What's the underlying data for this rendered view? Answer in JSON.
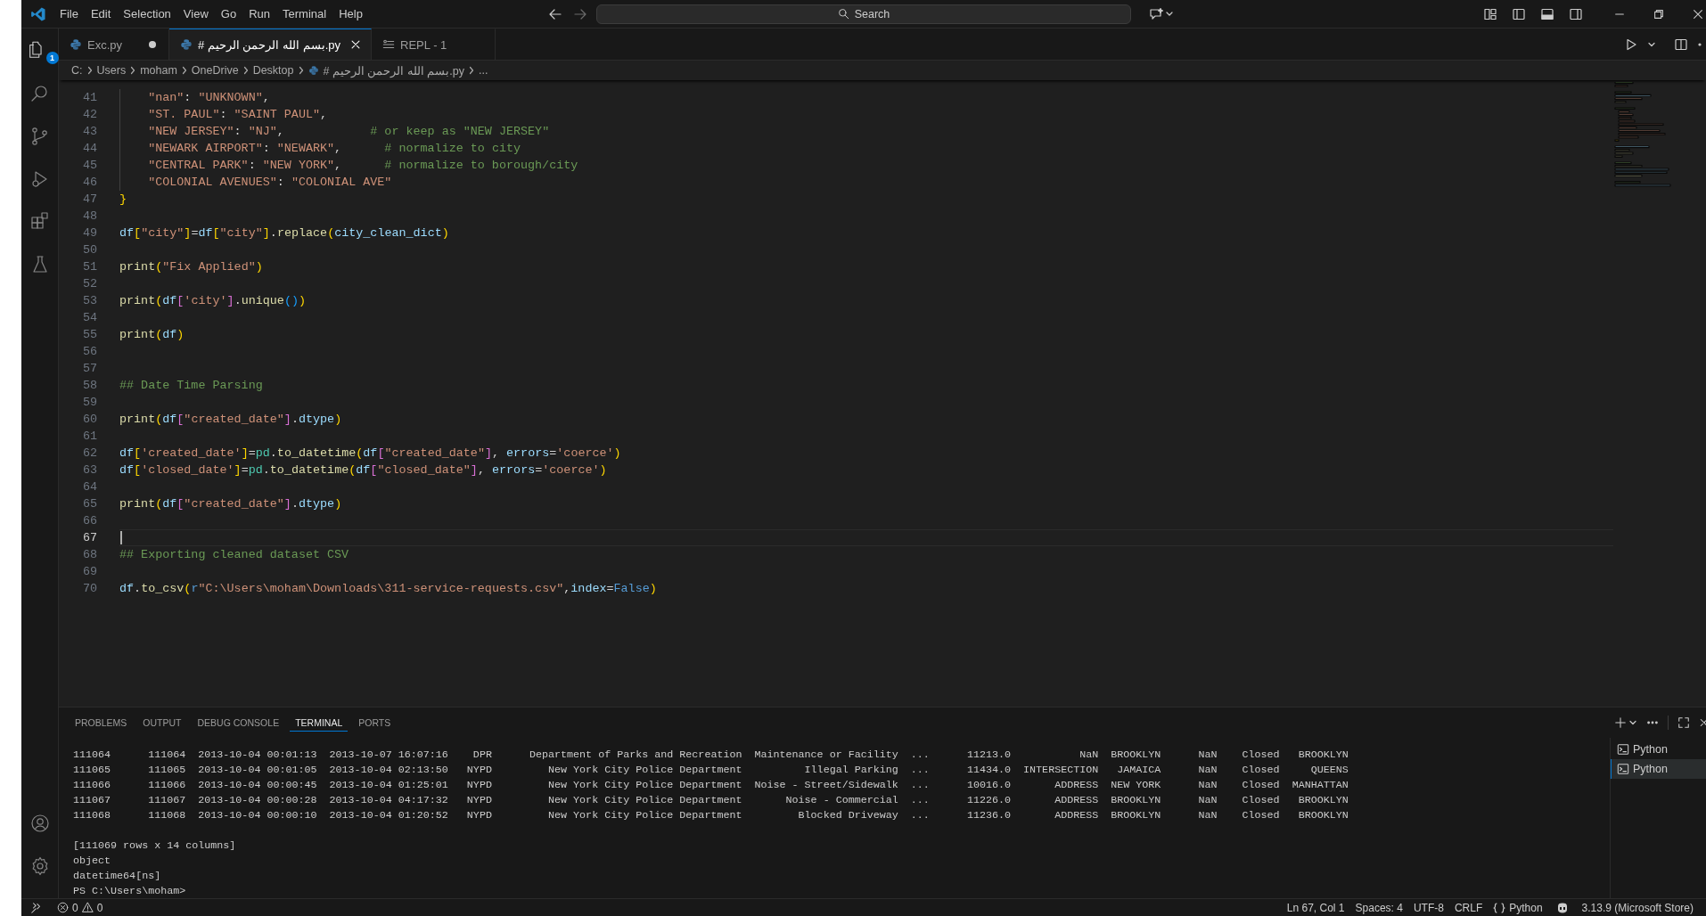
{
  "title_bar": {
    "menus": [
      "File",
      "Edit",
      "Selection",
      "View",
      "Go",
      "Run",
      "Terminal",
      "Help"
    ],
    "search": {
      "placeholder": "Search"
    }
  },
  "activity_bar": {
    "explorer_badge": "1"
  },
  "tabs": [
    {
      "label": "Exc.py",
      "kind": "python",
      "selected": false,
      "modified": true
    },
    {
      "label": "# بسم الله الرحمن الرحيم.py",
      "kind": "python",
      "selected": true,
      "modified": false
    },
    {
      "label": "REPL - 1",
      "kind": "repl",
      "selected": false,
      "modified": false
    }
  ],
  "breadcrumbs": [
    {
      "label": "C:",
      "kind": "folder"
    },
    {
      "label": "Users",
      "kind": "folder"
    },
    {
      "label": "moham",
      "kind": "folder"
    },
    {
      "label": "OneDrive",
      "kind": "folder"
    },
    {
      "label": "Desktop",
      "kind": "folder"
    },
    {
      "label": "# بسم الله الرحمن الرحيم.py",
      "kind": "python"
    },
    {
      "label": "...",
      "kind": "more"
    }
  ],
  "editor": {
    "lines": [
      {
        "number": "41",
        "current": false,
        "indented": true,
        "tokens": [
          {
            "kind": "string",
            "text": "\"nan\""
          },
          {
            "kind": "plain",
            "text": ": "
          },
          {
            "kind": "string",
            "text": "\"UNKNOWN\""
          },
          {
            "kind": "plain",
            "text": ","
          }
        ]
      },
      {
        "number": "42",
        "current": false,
        "indented": true,
        "tokens": [
          {
            "kind": "string",
            "text": "\"ST. PAUL\""
          },
          {
            "kind": "plain",
            "text": ": "
          },
          {
            "kind": "string",
            "text": "\"SAINT PAUL\""
          },
          {
            "kind": "plain",
            "text": ","
          }
        ]
      },
      {
        "number": "43",
        "current": false,
        "indented": true,
        "tokens": [
          {
            "kind": "string",
            "text": "\"NEW JERSEY\""
          },
          {
            "kind": "plain",
            "text": ": "
          },
          {
            "kind": "string",
            "text": "\"NJ\""
          },
          {
            "kind": "plain",
            "text": ",            "
          },
          {
            "kind": "comment",
            "text": "# or keep as \"NEW JERSEY\""
          }
        ]
      },
      {
        "number": "44",
        "current": false,
        "indented": true,
        "tokens": [
          {
            "kind": "string",
            "text": "\"NEWARK AIRPORT\""
          },
          {
            "kind": "plain",
            "text": ": "
          },
          {
            "kind": "string",
            "text": "\"NEWARK\""
          },
          {
            "kind": "plain",
            "text": ",      "
          },
          {
            "kind": "comment",
            "text": "# normalize to city"
          }
        ]
      },
      {
        "number": "45",
        "current": false,
        "indented": true,
        "tokens": [
          {
            "kind": "string",
            "text": "\"CENTRAL PARK\""
          },
          {
            "kind": "plain",
            "text": ": "
          },
          {
            "kind": "string",
            "text": "\"NEW YORK\""
          },
          {
            "kind": "plain",
            "text": ",      "
          },
          {
            "kind": "comment",
            "text": "# normalize to borough/city"
          }
        ]
      },
      {
        "number": "46",
        "current": false,
        "indented": true,
        "tokens": [
          {
            "kind": "string",
            "text": "\"COLONIAL AVENUES\""
          },
          {
            "kind": "plain",
            "text": ": "
          },
          {
            "kind": "string",
            "text": "\"COLONIAL AVE\""
          }
        ]
      },
      {
        "number": "47",
        "current": false,
        "tokens": [
          {
            "kind": "bracket1",
            "text": "}"
          }
        ]
      },
      {
        "number": "48",
        "current": false
      },
      {
        "number": "49",
        "current": false,
        "tokens": [
          {
            "kind": "var",
            "text": "df"
          },
          {
            "kind": "bracket1",
            "text": "["
          },
          {
            "kind": "string",
            "text": "\"city\""
          },
          {
            "kind": "bracket1",
            "text": "]"
          },
          {
            "kind": "plain",
            "text": "="
          },
          {
            "kind": "var",
            "text": "df"
          },
          {
            "kind": "bracket1",
            "text": "["
          },
          {
            "kind": "string",
            "text": "\"city\""
          },
          {
            "kind": "bracket1",
            "text": "]"
          },
          {
            "kind": "plain",
            "text": "."
          },
          {
            "kind": "fn",
            "text": "replace"
          },
          {
            "kind": "bracket1",
            "text": "("
          },
          {
            "kind": "var",
            "text": "city_clean_dict"
          },
          {
            "kind": "bracket1",
            "text": ")"
          }
        ]
      },
      {
        "number": "50",
        "current": false
      },
      {
        "number": "51",
        "current": false,
        "tokens": [
          {
            "kind": "fn",
            "text": "print"
          },
          {
            "kind": "bracket1",
            "text": "("
          },
          {
            "kind": "string",
            "text": "\"Fix Applied\""
          },
          {
            "kind": "bracket1",
            "text": ")"
          }
        ]
      },
      {
        "number": "52",
        "current": false
      },
      {
        "number": "53",
        "current": false,
        "tokens": [
          {
            "kind": "fn",
            "text": "print"
          },
          {
            "kind": "bracket1",
            "text": "("
          },
          {
            "kind": "var",
            "text": "df"
          },
          {
            "kind": "bracket2",
            "text": "["
          },
          {
            "kind": "string",
            "text": "'city'"
          },
          {
            "kind": "bracket2",
            "text": "]"
          },
          {
            "kind": "plain",
            "text": "."
          },
          {
            "kind": "fn",
            "text": "unique"
          },
          {
            "kind": "bracket3",
            "text": "()"
          },
          {
            "kind": "bracket1",
            "text": ")"
          }
        ]
      },
      {
        "number": "54",
        "current": false
      },
      {
        "number": "55",
        "current": false,
        "tokens": [
          {
            "kind": "fn",
            "text": "print"
          },
          {
            "kind": "bracket1",
            "text": "("
          },
          {
            "kind": "var",
            "text": "df"
          },
          {
            "kind": "bracket1",
            "text": ")"
          }
        ]
      },
      {
        "number": "56",
        "current": false
      },
      {
        "number": "57",
        "current": false
      },
      {
        "number": "58",
        "current": false,
        "tokens": [
          {
            "kind": "comment",
            "text": "## Date Time Parsing"
          }
        ]
      },
      {
        "number": "59",
        "current": false
      },
      {
        "number": "60",
        "current": false,
        "tokens": [
          {
            "kind": "fn",
            "text": "print"
          },
          {
            "kind": "bracket1",
            "text": "("
          },
          {
            "kind": "var",
            "text": "df"
          },
          {
            "kind": "bracket2",
            "text": "["
          },
          {
            "kind": "string",
            "text": "\"created_date\""
          },
          {
            "kind": "bracket2",
            "text": "]"
          },
          {
            "kind": "plain",
            "text": "."
          },
          {
            "kind": "var",
            "text": "dtype"
          },
          {
            "kind": "bracket1",
            "text": ")"
          }
        ]
      },
      {
        "number": "61",
        "current": false
      },
      {
        "number": "62",
        "current": false,
        "tokens": [
          {
            "kind": "var",
            "text": "df"
          },
          {
            "kind": "bracket1",
            "text": "["
          },
          {
            "kind": "string",
            "text": "'created_date'"
          },
          {
            "kind": "bracket1",
            "text": "]"
          },
          {
            "kind": "plain",
            "text": "="
          },
          {
            "kind": "module",
            "text": "pd"
          },
          {
            "kind": "plain",
            "text": "."
          },
          {
            "kind": "fn",
            "text": "to_datetime"
          },
          {
            "kind": "bracket1",
            "text": "("
          },
          {
            "kind": "var",
            "text": "df"
          },
          {
            "kind": "bracket2",
            "text": "["
          },
          {
            "kind": "string",
            "text": "\"created_date\""
          },
          {
            "kind": "bracket2",
            "text": "]"
          },
          {
            "kind": "plain",
            "text": ", "
          },
          {
            "kind": "var",
            "text": "errors"
          },
          {
            "kind": "plain",
            "text": "="
          },
          {
            "kind": "string",
            "text": "'coerce'"
          },
          {
            "kind": "bracket1",
            "text": ")"
          }
        ]
      },
      {
        "number": "63",
        "current": false,
        "tokens": [
          {
            "kind": "var",
            "text": "df"
          },
          {
            "kind": "bracket1",
            "text": "["
          },
          {
            "kind": "string",
            "text": "'closed_date'"
          },
          {
            "kind": "bracket1",
            "text": "]"
          },
          {
            "kind": "plain",
            "text": "="
          },
          {
            "kind": "module",
            "text": "pd"
          },
          {
            "kind": "plain",
            "text": "."
          },
          {
            "kind": "fn",
            "text": "to_datetime"
          },
          {
            "kind": "bracket1",
            "text": "("
          },
          {
            "kind": "var",
            "text": "df"
          },
          {
            "kind": "bracket2",
            "text": "["
          },
          {
            "kind": "string",
            "text": "\"closed_date\""
          },
          {
            "kind": "bracket2",
            "text": "]"
          },
          {
            "kind": "plain",
            "text": ", "
          },
          {
            "kind": "var",
            "text": "errors"
          },
          {
            "kind": "plain",
            "text": "="
          },
          {
            "kind": "string",
            "text": "'coerce'"
          },
          {
            "kind": "bracket1",
            "text": ")"
          }
        ]
      },
      {
        "number": "64",
        "current": false
      },
      {
        "number": "65",
        "current": false,
        "tokens": [
          {
            "kind": "fn",
            "text": "print"
          },
          {
            "kind": "bracket1",
            "text": "("
          },
          {
            "kind": "var",
            "text": "df"
          },
          {
            "kind": "bracket2",
            "text": "["
          },
          {
            "kind": "string",
            "text": "\"created_date\""
          },
          {
            "kind": "bracket2",
            "text": "]"
          },
          {
            "kind": "plain",
            "text": "."
          },
          {
            "kind": "var",
            "text": "dtype"
          },
          {
            "kind": "bracket1",
            "text": ")"
          }
        ]
      },
      {
        "number": "66",
        "current": false
      },
      {
        "number": "67",
        "current": true
      },
      {
        "number": "68",
        "current": false,
        "tokens": [
          {
            "kind": "comment",
            "text": "## Exporting cleaned dataset CSV"
          }
        ]
      },
      {
        "number": "69",
        "current": false
      },
      {
        "number": "70",
        "current": false,
        "tokens": [
          {
            "kind": "var",
            "text": "df"
          },
          {
            "kind": "plain",
            "text": "."
          },
          {
            "kind": "fn",
            "text": "to_csv"
          },
          {
            "kind": "bracket1",
            "text": "("
          },
          {
            "kind": "const",
            "text": "r"
          },
          {
            "kind": "string",
            "text": "\"C:\\Users\\moham\\Downloads\\311-service-requests.csv\""
          },
          {
            "kind": "plain",
            "text": ","
          },
          {
            "kind": "var",
            "text": "index"
          },
          {
            "kind": "plain",
            "text": "="
          },
          {
            "kind": "const",
            "text": "False"
          },
          {
            "kind": "bracket1",
            "text": ")"
          }
        ]
      }
    ]
  },
  "panel": {
    "tabs": [
      {
        "label": "PROBLEMS",
        "selected": false
      },
      {
        "label": "OUTPUT",
        "selected": false
      },
      {
        "label": "DEBUG CONSOLE",
        "selected": false
      },
      {
        "label": "TERMINAL",
        "selected": true
      },
      {
        "label": "PORTS",
        "selected": false
      }
    ],
    "output": {
      "rows": [
        "111064      111064  2013-10-04 00:01:13  2013-10-07 16:07:16    DPR      Department of Parks and Recreation  Maintenance or Facility  ...      11213.0           NaN  BROOKLYN      NaN    Closed   BROOKLYN",
        "111065      111065  2013-10-04 00:01:05  2013-10-04 02:13:50   NYPD         New York City Police Department          Illegal Parking  ...      11434.0  INTERSECTION   JAMAICA      NaN    Closed     QUEENS",
        "111066      111066  2013-10-04 00:00:45  2013-10-04 01:25:01   NYPD         New York City Police Department  Noise - Street/Sidewalk  ...      10016.0       ADDRESS  NEW YORK      NaN    Closed  MANHATTAN",
        "111067      111067  2013-10-04 00:00:28  2013-10-04 04:17:32   NYPD         New York City Police Department       Noise - Commercial  ...      11226.0       ADDRESS  BROOKLYN      NaN    Closed   BROOKLYN",
        "111068      111068  2013-10-04 00:00:10  2013-10-04 01:20:52   NYPD         New York City Police Department         Blocked Driveway  ...      11236.0       ADDRESS  BROOKLYN      NaN    Closed   BROOKLYN"
      ],
      "summary_lines": [
        "[111069 rows x 14 columns]",
        "object",
        "datetime64[ns]",
        "PS C:\\Users\\moham>"
      ]
    },
    "terminals": [
      {
        "label": "Python",
        "selected": false
      },
      {
        "label": "Python",
        "selected": true
      }
    ]
  },
  "status_bar": {
    "errors": "0",
    "warnings": "0",
    "items": [
      {
        "kind": "text",
        "label": "Ln 67, Col 1"
      },
      {
        "kind": "text",
        "label": "Spaces: 4"
      },
      {
        "kind": "text",
        "label": "UTF-8"
      },
      {
        "kind": "text",
        "label": "CRLF"
      },
      {
        "kind": "language",
        "label": "Python"
      },
      {
        "kind": "copilot"
      },
      {
        "kind": "text",
        "label": "3.13.9 (Microsoft Store)"
      }
    ]
  }
}
